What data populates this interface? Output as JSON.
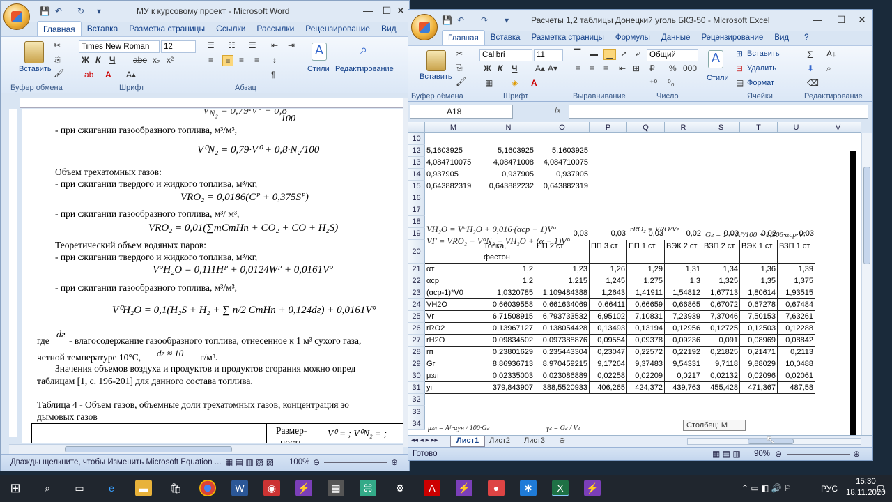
{
  "word": {
    "title": "МУ к курсовому проект - Microsoft Word",
    "tabs": [
      "Главная",
      "Вставка",
      "Разметка страницы",
      "Ссылки",
      "Рассылки",
      "Рецензирование",
      "Вид"
    ],
    "font_name": "Times New Roman",
    "font_size": "12",
    "groups": {
      "clipboard": "Буфер обмена",
      "font": "Шрифт",
      "paragraph": "Абзац",
      "styles": "Стили",
      "editing": "Редактирование"
    },
    "paste_label": "Вставить",
    "styles_label": "Стили",
    "editing_label": "Редактирование",
    "lines": {
      "l1": "- при сжигании газообразного топлива, м³/м³,",
      "l2": "Объем трехатомных газов:",
      "l3": "- при сжигании твердого и жидкого топлива, м³/кг,",
      "l4": "- при сжигании газообразного топлива, м³/ м³,",
      "l5": "Теоретический объем водяных паров:",
      "l6": "- при сжигании твердого и жидкого топлива, м³/кг,",
      "l7": "- при сжигании газообразного топлива, м³/м³,",
      "l8a": "где",
      "l8b": "- влагосодержание газообразного топлива, отнесенное к 1 м³ сухого газа,",
      "l9a": "четной температуре 10°С,",
      "l9b": "г/м³.",
      "l10": "Значения объемов воздуха и продуктов и продуктов сгорания можно опред",
      "l11": "таблицам [1, с. 196-201] для данного состава топлива.",
      "l12": "Таблица 4 - Объем газов, объемные доли трехатомных газов, концентрация зо",
      "l13": "дымовых газов",
      "t1": "Размер-",
      "t2": "ность"
    },
    "equations": {
      "e1": "V⁰N₂ = 0,79·V⁰ + 0,8·N₂/100",
      "e2": "VRO₂ = 0,0186(Cᴾ + 0,375Sᴾ)",
      "e3": "VRO₂ = 0,01(∑mCmHn + CO₂ + CO + H₂S)",
      "e4": "V°H₂O = 0,111Hᴾ + 0,0124Wᴾ + 0,0161V°",
      "e5": "V⁰H₂O = 0,1(H₂S + H₂ + ∑ n/2 CmHn + 0,124dг) + 0,0161V°",
      "e6": "dг",
      "e7": "dг ≈ 10",
      "e8": "V⁰ = ;  V⁰N₂ = ;"
    },
    "status": "Дважды щелкните, чтобы Изменить Microsoft Equation ...",
    "zoom": "100%"
  },
  "excel": {
    "title": "Расчеты 1,2 таблицы Донецкий уголь БКЗ-50 - Microsoft Excel",
    "tabs": [
      "Главная",
      "Вставка",
      "Разметка страницы",
      "Формулы",
      "Данные",
      "Рецензирование",
      "Вид"
    ],
    "font_name": "Calibri",
    "font_size": "11",
    "number_format": "Общий",
    "paste_label": "Вставить",
    "styles_label": "Стили",
    "insert_label": "Вставить",
    "delete_label": "Удалить",
    "format_label": "Формат",
    "groups": {
      "clipboard": "Буфер обмена",
      "font": "Шрифт",
      "align": "Выравнивание",
      "number": "Число",
      "cells": "Ячейки",
      "editing": "Редактирование"
    },
    "name_box": "A18",
    "fx": "fx",
    "columns": [
      "M",
      "N",
      "O",
      "P",
      "Q",
      "R",
      "S",
      "T",
      "U",
      "V"
    ],
    "rows": {
      "r10": {
        "n": "10",
        "v": [
          "",
          "",
          "",
          "",
          "",
          "",
          "",
          "",
          "",
          ""
        ]
      },
      "r12": {
        "n": "12",
        "v": [
          "5,1603925",
          "5,1603925",
          "5,1603925",
          "",
          "",
          "",
          "",
          "",
          "",
          ""
        ]
      },
      "r13": {
        "n": "13",
        "v": [
          "4,084710075",
          "4,08471008",
          "4,084710075",
          "",
          "",
          "",
          "",
          "",
          "",
          ""
        ]
      },
      "r14": {
        "n": "14",
        "v": [
          "0,937905",
          "0,937905",
          "0,937905",
          "",
          "",
          "",
          "",
          "",
          "",
          ""
        ]
      },
      "r15": {
        "n": "15",
        "v": [
          "0,643882319",
          "0,643882232",
          "0,643882319",
          "",
          "",
          "",
          "",
          "",
          "",
          ""
        ]
      },
      "r16": {
        "n": "16",
        "v": [
          "",
          "",
          "",
          "",
          "",
          "",
          "",
          "",
          "",
          ""
        ]
      },
      "r17": {
        "n": "17",
        "v": [
          "",
          "",
          "",
          "",
          "",
          "",
          "",
          "",
          "",
          ""
        ]
      },
      "r18": {
        "n": "18",
        "v": [
          "",
          "",
          "",
          "",
          "",
          "",
          "",
          "",
          "",
          ""
        ]
      },
      "r19": {
        "n": "19",
        "v": [
          "",
          "",
          "0,03",
          "0,03",
          "0,03",
          "0,02",
          "0,03",
          "0,02",
          "0,03",
          ""
        ]
      },
      "r20": {
        "n": "20",
        "v": [
          "",
          "Топка, фестон",
          "ПП 2 ст",
          "ПП 3 ст",
          "ПП 1 ст",
          "ВЭК 2 ст",
          "ВЗП 2 ст",
          "ВЭК 1 ст",
          "ВЗП 1 ст",
          ""
        ]
      },
      "r21": {
        "n": "21",
        "v": [
          "αт",
          "1,2",
          "1,23",
          "1,26",
          "1,29",
          "1,31",
          "1,34",
          "1,36",
          "1,39",
          ""
        ]
      },
      "r22": {
        "n": "22",
        "v": [
          "αср",
          "1,2",
          "1,215",
          "1,245",
          "1,275",
          "1,3",
          "1,325",
          "1,35",
          "1,375",
          ""
        ]
      },
      "r23": {
        "n": "23",
        "v": [
          "(αср-1)*V0",
          "1,0320785",
          "1,109484388",
          "1,2643",
          "1,41911",
          "1,54812",
          "1,67713",
          "1,80614",
          "1,93515",
          ""
        ]
      },
      "r24": {
        "n": "24",
        "v": [
          "VH2O",
          "0,66039558",
          "0,661634069",
          "0,66411",
          "0,66659",
          "0,66865",
          "0,67072",
          "0,67278",
          "0,67484",
          ""
        ]
      },
      "r25": {
        "n": "25",
        "v": [
          "Vг",
          "6,71508915",
          "6,793733532",
          "6,95102",
          "7,10831",
          "7,23939",
          "7,37046",
          "7,50153",
          "7,63261",
          ""
        ]
      },
      "r26": {
        "n": "26",
        "v": [
          "rRO2",
          "0,13967127",
          "0,138054428",
          "0,13493",
          "0,13194",
          "0,12956",
          "0,12725",
          "0,12503",
          "0,12288",
          ""
        ]
      },
      "r27": {
        "n": "27",
        "v": [
          "rH2O",
          "0,09834502",
          "0,097388876",
          "0,09554",
          "0,09378",
          "0,09236",
          "0,091",
          "0,08969",
          "0,08842",
          ""
        ]
      },
      "r28": {
        "n": "28",
        "v": [
          "rп",
          "0,23801629",
          "0,235443304",
          "0,23047",
          "0,22572",
          "0,22192",
          "0,21825",
          "0,21471",
          "0,2113",
          ""
        ]
      },
      "r29": {
        "n": "29",
        "v": [
          "Gг",
          "8,86936713",
          "8,970459215",
          "9,17264",
          "9,37483",
          "9,54331",
          "9,7118",
          "9,88029",
          "10,0488",
          ""
        ]
      },
      "r30": {
        "n": "30",
        "v": [
          "μзл",
          "0,02335003",
          "0,023086889",
          "0,02258",
          "0,02209",
          "0,0217",
          "0,02132",
          "0,02096",
          "0,02061",
          ""
        ]
      },
      "r31": {
        "n": "31",
        "v": [
          "yг",
          "379,843907",
          "388,5520933",
          "406,265",
          "424,372",
          "439,763",
          "455,428",
          "471,367",
          "487,58",
          ""
        ]
      },
      "r32": {
        "n": "32",
        "v": [
          "",
          "",
          "",
          "",
          "",
          "",
          "",
          "",
          "",
          ""
        ]
      },
      "r33": {
        "n": "33",
        "v": [
          "",
          "",
          "",
          "",
          "",
          "",
          "",
          "",
          "",
          ""
        ]
      },
      "r34": {
        "n": "34",
        "v": [
          "",
          "",
          "",
          "",
          "",
          "",
          "",
          "",
          "",
          ""
        ]
      }
    },
    "eq": {
      "q17": "VH₂O = V°H₂O + 0,016·(αср − 1)V°",
      "q18": "VГ = VRO₂ + V°N₂ + VH₂O + (α − 1)V°",
      "qr": "rRO₂ = VRO/Vг",
      "qg": "Gг = 1 − Aᴾ/100 + 1,306·αср·V°",
      "q33": "μзл = Aᴾ·αун / 100·Gг",
      "q33b": "γг = Gг / Vг"
    },
    "sheets": [
      "Лист1",
      "Лист2",
      "Лист3"
    ],
    "status": "Готово",
    "zoom": "90%",
    "tooltip": "Столбец: M"
  },
  "taskbar": {
    "time": "15:30",
    "date": "18.11.2020",
    "lang": "РУС"
  }
}
